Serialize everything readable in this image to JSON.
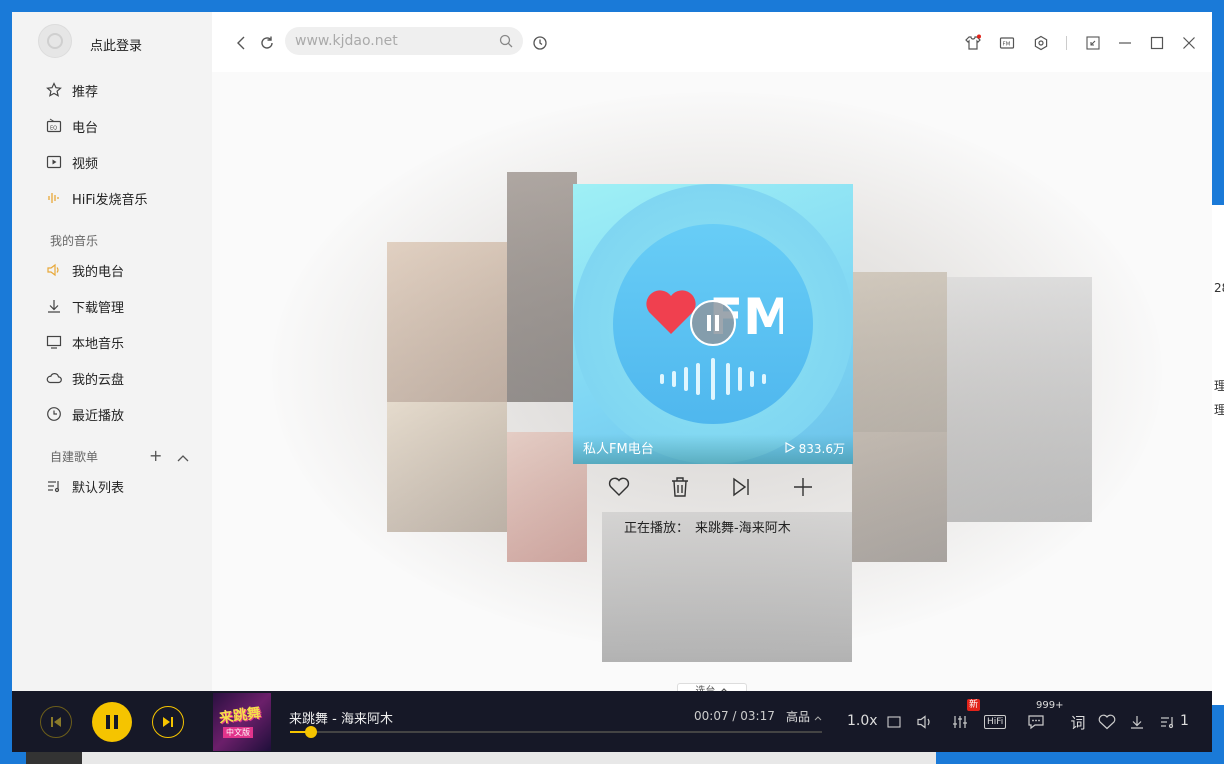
{
  "sidebar": {
    "login_text": "点此登录",
    "nav": [
      {
        "label": "推荐",
        "icon": "star-icon"
      },
      {
        "label": "电台",
        "icon": "radio-icon"
      },
      {
        "label": "视频",
        "icon": "video-icon"
      },
      {
        "label": "HiFi发烧音乐",
        "icon": "hifi-wave-icon"
      }
    ],
    "my_music_header": "我的音乐",
    "my_music": [
      {
        "label": "我的电台",
        "icon": "speaker-icon"
      },
      {
        "label": "下载管理",
        "icon": "download-icon"
      },
      {
        "label": "本地音乐",
        "icon": "monitor-icon"
      },
      {
        "label": "我的云盘",
        "icon": "cloud-icon"
      },
      {
        "label": "最近播放",
        "icon": "clock-icon"
      }
    ],
    "playlists_header": "自建歌单",
    "playlists": [
      {
        "label": "默认列表",
        "icon": "playlist-icon"
      }
    ]
  },
  "topbar": {
    "search_placeholder": "www.kjdao.net",
    "icons": [
      "back-icon",
      "refresh-icon",
      "search-icon",
      "history-icon",
      "skin-icon",
      "fm-mini-icon",
      "settings-icon",
      "mini-mode-icon",
      "minimize-icon",
      "maximize-icon",
      "close-icon"
    ]
  },
  "main": {
    "card": {
      "logo_text": "FM",
      "title": "私人FM电台",
      "play_count": "833.6万"
    },
    "now_playing_label": "正在播放：",
    "now_playing_value": "来跳舞-海来阿木",
    "switch_label": "选台"
  },
  "player": {
    "song": "来跳舞 - 海来阿木",
    "time_current": "00:07",
    "time_total": "03:17",
    "quality": "高品",
    "progress": 0.04,
    "speed": "1.0x",
    "new_badge": "新",
    "hifi_label": "HiFi",
    "comment_count": "999+",
    "lyric_label": "词",
    "queue_count": "1",
    "cover_text": "来跳舞",
    "cover_sub": "中文版"
  },
  "desktop": {
    "edge_texts": [
      "28",
      "理",
      "理"
    ]
  },
  "colors": {
    "accent": "#f5c400",
    "player_bg": "#161827",
    "sidebar_bg": "#f3f3f3",
    "card_cyan": "#7fd6f4",
    "heart_red": "#f0404f"
  }
}
